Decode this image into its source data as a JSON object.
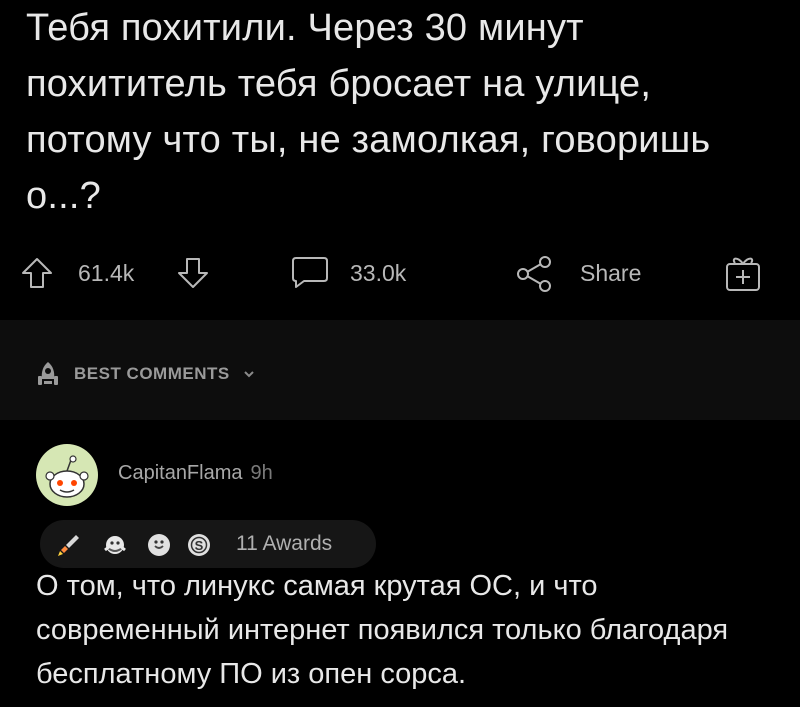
{
  "post": {
    "title": "Тебя похитили. Через 30 минут похититель тебя бросает на улице, потому что ты, не замолкая, говоришь о...?"
  },
  "actions": {
    "vote_count": "61.4k",
    "comment_count": "33.0k",
    "share_label": "Share",
    "icons": [
      "upvote-icon",
      "downvote-icon",
      "comment-icon",
      "share-icon",
      "award-icon"
    ]
  },
  "sort": {
    "label": "BEST COMMENTS",
    "icon": "rocket-icon"
  },
  "comment": {
    "author": "CapitanFlama",
    "time": "9h",
    "awards_label": "11 Awards",
    "body": "О том, что линукс самая крутая ОС, и что современный интернет появился только благодаря бесплатному ПО из опен сорса."
  },
  "colors": {
    "background": "#000000",
    "section_bar": "#0d0d0d",
    "text": "#e8e8e8",
    "muted": "#b8b8b8"
  }
}
